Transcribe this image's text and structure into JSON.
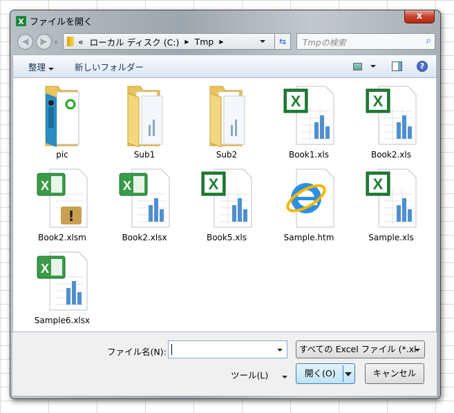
{
  "window": {
    "title": "ファイルを開く",
    "close": "x"
  },
  "nav": {
    "breadcrumb_prefix": "«",
    "path": [
      "ローカル ディスク (C:)",
      "Tmp"
    ],
    "search_placeholder": "Tmpの検索"
  },
  "toolbar": {
    "organize": "整理",
    "new_folder": "新しいフォルダー"
  },
  "files": [
    {
      "name": "pic",
      "type": "folder-pic"
    },
    {
      "name": "Sub1",
      "type": "folder"
    },
    {
      "name": "Sub2",
      "type": "folder"
    },
    {
      "name": "Book1.xls",
      "type": "xls"
    },
    {
      "name": "Book2.xls",
      "type": "xls"
    },
    {
      "name": "Book2.xlsm",
      "type": "xlsm"
    },
    {
      "name": "Book2.xlsx",
      "type": "xlsx"
    },
    {
      "name": "Book5.xls",
      "type": "xls"
    },
    {
      "name": "Sample.htm",
      "type": "htm"
    },
    {
      "name": "Sample.xls",
      "type": "xls"
    },
    {
      "name": "Sample6.xlsx",
      "type": "xlsx"
    }
  ],
  "bottom": {
    "filename_label": "ファイル名(N):",
    "filename_value": "",
    "filetype": "すべての Excel ファイル (*.xl",
    "tools": "ツール(L)",
    "open": "開く(O)",
    "cancel": "キャンセル"
  }
}
